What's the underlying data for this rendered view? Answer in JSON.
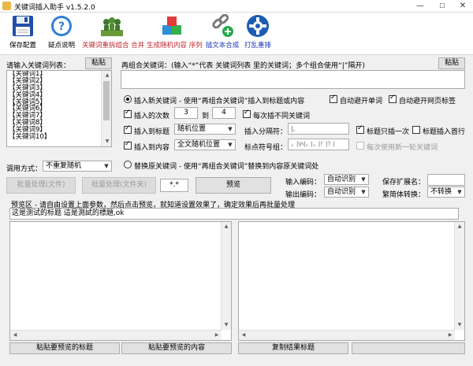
{
  "window": {
    "title": "关键词插入助手 v1.5.2.0",
    "minimize": "—",
    "maximize": "☐",
    "close": "✕"
  },
  "toolbar": [
    {
      "label": "保存配置",
      "icon": "floppy-disk-icon",
      "color": "#1a1a1a"
    },
    {
      "label": "疑点说明",
      "icon": "help-question-icon",
      "color": "#1a1a1a"
    },
    {
      "label": "关键词重拆组合 合并",
      "icon": "people-group-icon",
      "color": "#c0262d"
    },
    {
      "label": "生成随机内容 序列",
      "icon": "color-cubes-icon",
      "color": "#c0262d"
    },
    {
      "label": "插文本合成",
      "icon": "chain-link-plus-icon",
      "color": "#1a37b8"
    },
    {
      "label": "打乱重排",
      "icon": "gear-icon",
      "color": "#1a37b8"
    }
  ],
  "keywords": {
    "label": "请输入关键词列表：",
    "paste_label": "粘贴",
    "items": [
      "【关键词1】",
      "【关键词2】",
      "【关键词3】",
      "【关键词4】",
      "【关键词5】",
      "【关键词6】",
      "【关键词7】",
      "【关键词8】",
      "【关键词9】",
      "【关键词10】"
    ]
  },
  "recombine": {
    "label": "再组合关键词：(输入“*”代表 关键词列表 里的关键词；多个组合使用“|”隔开)",
    "paste_label": "粘贴"
  },
  "insert_mode": {
    "label": "插入新关键词 - 使用“再组合关键词”插入到标题或内容",
    "selected": true,
    "auto_avoid_word": "自动避开单词",
    "auto_avoid_tag": "自动避开网页标签",
    "count_label": "插入的次数",
    "count_min": "3",
    "count_to": "到",
    "count_max": "4",
    "diff_each": "每次插不同关键词",
    "to_title": "插入到标题",
    "title_pos": "随机位置",
    "separator_label": "插入分隔符：",
    "separator_value": "|,",
    "title_once": "标题只插一次",
    "title_first": "标题插入首行",
    "to_content": "插入到内容",
    "content_pos": "全文随机位置",
    "punct_label": "标点符号组：",
    "punct_value": "，|\\n|，|，|！|？|",
    "new_round": "每次使用新一轮关键词"
  },
  "replace_mode": {
    "label": "替换原关键词 - 使用“再组合关键词”替换到内容原关键词处",
    "selected": false
  },
  "call_mode": {
    "label": "调用方式：",
    "value": "不重复随机"
  },
  "batch": {
    "file_label": "批量处理(文件)",
    "folder_label": "批量处理(文件夹)",
    "ext_value": "*.*",
    "preview_label": "预览"
  },
  "encoding": {
    "input_label": "输入编码：",
    "input_value": "自动识别",
    "output_label": "输出编码：",
    "output_value": "自动识别",
    "save_ext_label": "保存扩展名：",
    "save_ext_value": "",
    "convert_label": "繁简体转换：",
    "convert_value": "不转换"
  },
  "preview": {
    "hint": "预览区 - 请自由设置上面参数，然后点击预览，就知道设置效果了，确定效果后再批量处理",
    "input_text": "这是测试的标题 這是測試的標題,ok",
    "paste_title": "粘贴要预览的标题",
    "paste_content": "粘贴要预览的内容",
    "copy_title": "复制结果标题"
  }
}
